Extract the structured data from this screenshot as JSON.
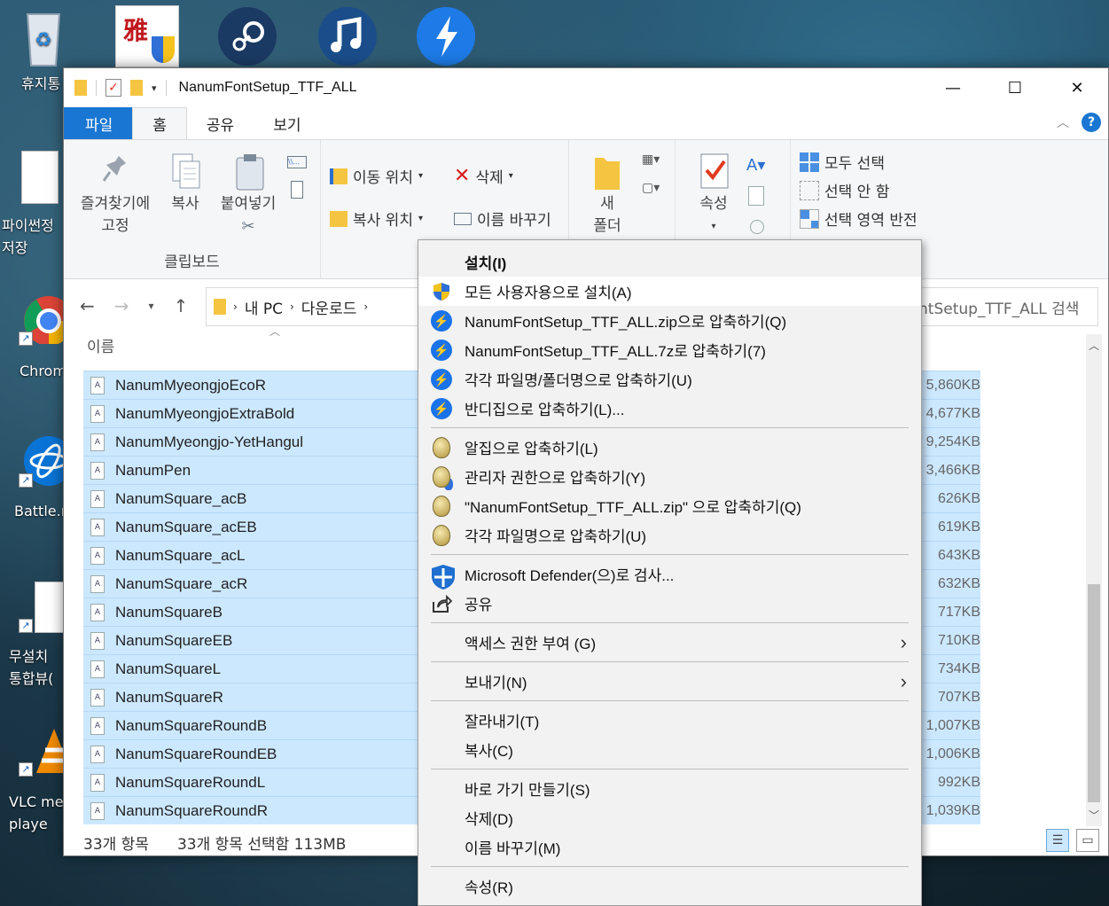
{
  "desktop": {
    "icons": [
      {
        "label": "휴지통",
        "icon": "recycle-bin-icon"
      },
      {
        "label": "파이썬정\n저장",
        "icon": "document-icon"
      },
      {
        "label": "Chrom",
        "icon": "chrome-icon"
      },
      {
        "label": "Battle.n",
        "icon": "battlenet-icon"
      },
      {
        "label": "무설치\n통합뷰(",
        "icon": "document-icon"
      },
      {
        "label": "VLC me\nplaye",
        "icon": "vlc-icon"
      }
    ]
  },
  "window": {
    "title": "NanumFontSetup_TTF_ALL",
    "tabs": [
      "파일",
      "홈",
      "공유",
      "보기"
    ],
    "ribbon": {
      "pin_label": "즐겨찾기에\n고정",
      "copy_label": "복사",
      "paste_label": "붙여넣기",
      "clipboard_group": "클립보드",
      "move_to": "이동 위치",
      "copy_to": "복사 위치",
      "delete": "삭제",
      "rename": "이름 바꾸기",
      "new_folder": "새\n폴더",
      "properties": "속성",
      "select_all": "모두 선택",
      "select_none": "선택 안 함",
      "invert_selection": "선택 영역 반전"
    },
    "address": {
      "crumbs": [
        "내 PC",
        "다운로드"
      ],
      "search_placeholder": "ntSetup_TTF_ALL 검색"
    },
    "column_name": "이름",
    "files": [
      {
        "name": "NanumMyeongjoEcoR",
        "size": "5,860KB"
      },
      {
        "name": "NanumMyeongjoExtraBold",
        "size": "4,677KB"
      },
      {
        "name": "NanumMyeongjo-YetHangul",
        "size": "9,254KB"
      },
      {
        "name": "NanumPen",
        "size": "3,466KB"
      },
      {
        "name": "NanumSquare_acB",
        "size": "626KB"
      },
      {
        "name": "NanumSquare_acEB",
        "size": "619KB"
      },
      {
        "name": "NanumSquare_acL",
        "size": "643KB"
      },
      {
        "name": "NanumSquare_acR",
        "size": "632KB"
      },
      {
        "name": "NanumSquareB",
        "size": "717KB"
      },
      {
        "name": "NanumSquareEB",
        "size": "710KB"
      },
      {
        "name": "NanumSquareL",
        "size": "734KB"
      },
      {
        "name": "NanumSquareR",
        "size": "707KB"
      },
      {
        "name": "NanumSquareRoundB",
        "size": "1,007KB"
      },
      {
        "name": "NanumSquareRoundEB",
        "size": "1,006KB"
      },
      {
        "name": "NanumSquareRoundL",
        "size": "992KB"
      },
      {
        "name": "NanumSquareRoundR",
        "size": "1,039KB"
      }
    ],
    "status": {
      "count": "33개 항목",
      "selected": "33개 항목 선택함 113MB"
    }
  },
  "context_menu": {
    "items": [
      {
        "label": "설치(I)",
        "icon": "",
        "bold": true
      },
      {
        "label": "모든 사용자용으로 설치(A)",
        "icon": "uac-shield-icon",
        "highlight": true
      },
      {
        "label": "NanumFontSetup_TTF_ALL.zip으로 압축하기(Q)",
        "icon": "bandizip-icon"
      },
      {
        "label": "NanumFontSetup_TTF_ALL.7z로 압축하기(7)",
        "icon": "bandizip-icon"
      },
      {
        "label": "각각 파일명/폴더명으로 압축하기(U)",
        "icon": "bandizip-icon"
      },
      {
        "label": "반디집으로 압축하기(L)...",
        "icon": "bandizip-icon"
      },
      {
        "sep": true
      },
      {
        "label": "알집으로 압축하기(L)",
        "icon": "alzip-icon"
      },
      {
        "label": "관리자 권한으로 압축하기(Y)",
        "icon": "alzip-admin-icon"
      },
      {
        "label": "\"NanumFontSetup_TTF_ALL.zip\" 으로 압축하기(Q)",
        "icon": "alzip-icon"
      },
      {
        "label": "각각 파일명으로 압축하기(U)",
        "icon": "alzip-icon"
      },
      {
        "sep": true
      },
      {
        "label": "Microsoft Defender(으)로 검사...",
        "icon": "defender-icon"
      },
      {
        "label": "공유",
        "icon": "share-icon"
      },
      {
        "sep": true
      },
      {
        "label": "액세스 권한 부여 (G)",
        "icon": "",
        "submenu": true
      },
      {
        "sep": true
      },
      {
        "label": "보내기(N)",
        "icon": "",
        "submenu": true
      },
      {
        "sep": true
      },
      {
        "label": "잘라내기(T)",
        "icon": ""
      },
      {
        "label": "복사(C)",
        "icon": ""
      },
      {
        "sep": true
      },
      {
        "label": "바로 가기 만들기(S)",
        "icon": ""
      },
      {
        "label": "삭제(D)",
        "icon": ""
      },
      {
        "label": "이름 바꾸기(M)",
        "icon": ""
      },
      {
        "sep": true
      },
      {
        "label": "속성(R)",
        "icon": ""
      }
    ]
  },
  "colors": {
    "accent": "#1976d2",
    "selection": "#cce8ff",
    "menu_bg": "#f2f2f2"
  }
}
